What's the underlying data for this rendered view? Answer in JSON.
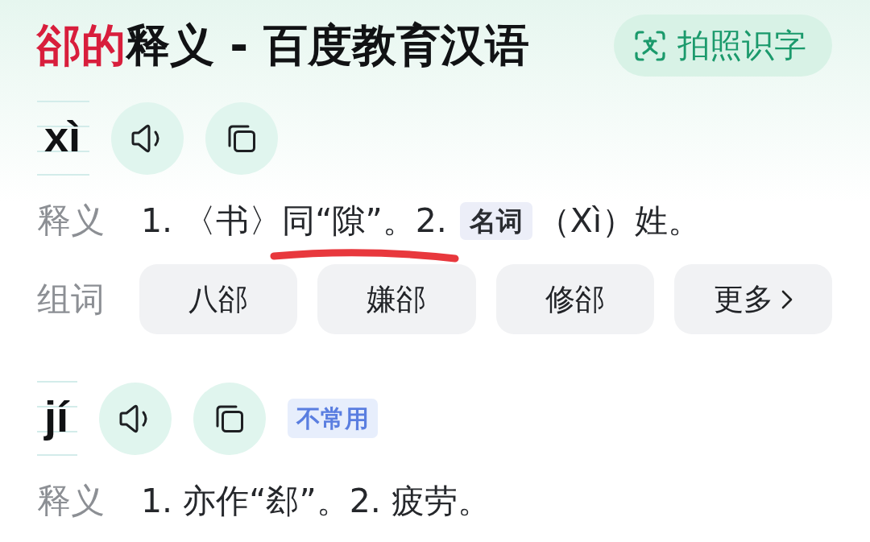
{
  "header": {
    "title_highlight": "郤的",
    "title": "释义 - 百度教育汉语",
    "scan_button": "拍照识字"
  },
  "readings": [
    {
      "pinyin": "xì",
      "definition_label": "释义",
      "definition": [
        {
          "kind": "text",
          "text": "1. 〈书〉同“隙”。2."
        },
        {
          "kind": "tag",
          "text": "名词"
        },
        {
          "kind": "text",
          "text": "（Xì）姓。"
        }
      ],
      "words_label": "组词",
      "words": [
        "八郤",
        "嫌郤",
        "修郤"
      ],
      "more": "更多"
    },
    {
      "pinyin": "jí",
      "badge": "不常用",
      "definition_label": "释义",
      "definition": [
        {
          "kind": "text",
          "text": "1. 亦作“郄”。2. 疲劳。"
        }
      ]
    }
  ],
  "annotations": [
    {
      "kind": "underline"
    }
  ]
}
